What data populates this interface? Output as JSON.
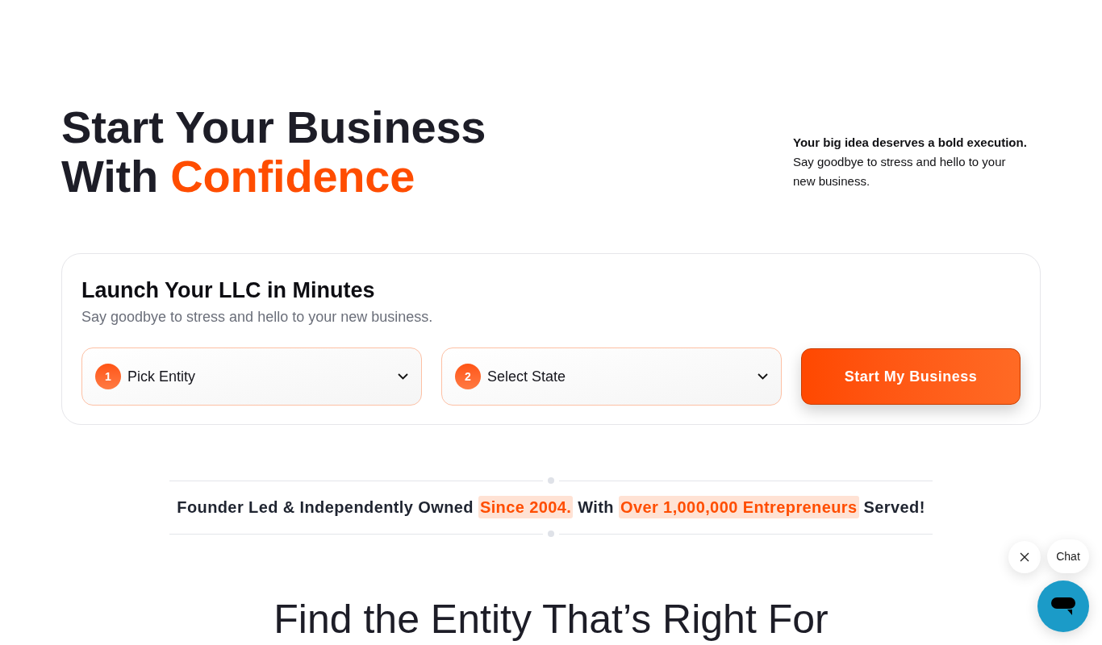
{
  "hero": {
    "title_lines": [
      [
        {
          "text": "Start Your Business",
          "accent": false
        }
      ],
      [
        {
          "text": "With",
          "accent": false
        },
        {
          "text": "Confidence",
          "accent": true
        }
      ]
    ],
    "tagline": {
      "lead": "Your big idea deserves a bold execution.",
      "text": "Say goodbye to stress and hello to your new business."
    }
  },
  "launch_card": {
    "title": "Launch Your LLC in Minutes",
    "subtitle": "Say goodbye to stress and hello to your new business.",
    "dropdowns": [
      {
        "step": "1",
        "label": "Pick Entity"
      },
      {
        "step": "2",
        "label": "Select State"
      }
    ],
    "button": "Start My Business"
  },
  "stats_banner": {
    "segments": [
      {
        "text": "Founder Led & Independently Owned",
        "highlighted": false
      },
      {
        "text": "Since 2004.",
        "highlighted": true
      },
      {
        "text": "With",
        "highlighted": false
      },
      {
        "text": "Over 1,000,000 Entrepreneurs",
        "highlighted": true
      },
      {
        "text": "Served!",
        "highlighted": false
      }
    ]
  },
  "section_heading": "Find the Entity That’s Right For",
  "chat_widget": {
    "label": "Chat"
  }
}
